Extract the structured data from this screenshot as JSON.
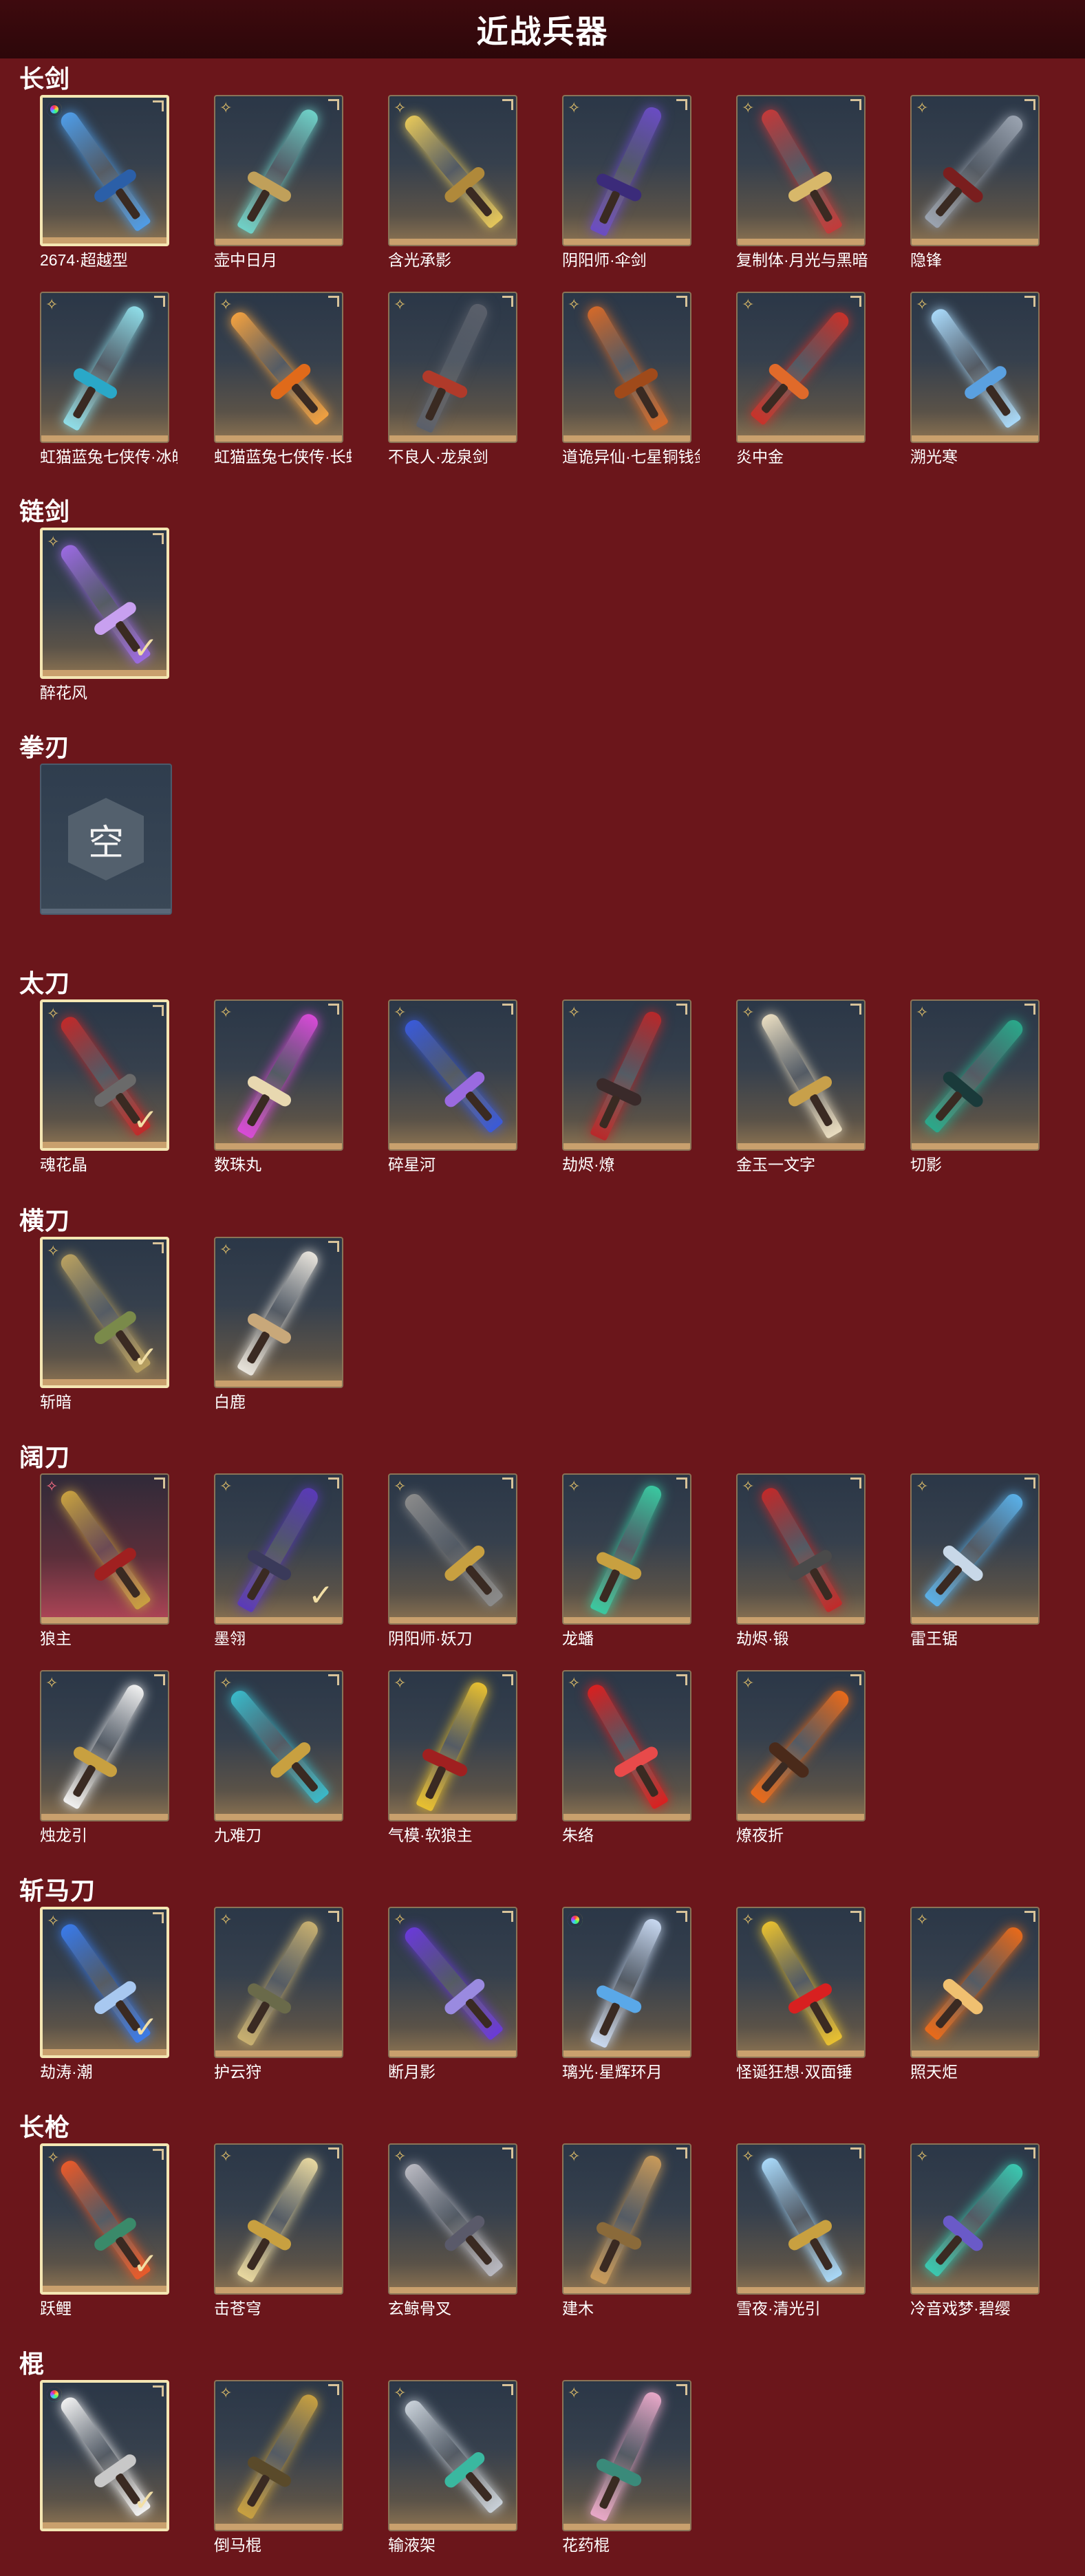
{
  "header": {
    "title": "近战兵器"
  },
  "sections": [
    {
      "key": "changjian",
      "title": "长剑",
      "rows": [
        [
          {
            "label": "2674·超越型",
            "rarity": "rainbow",
            "selected": true,
            "checked": false,
            "blade": "#4f9ce6",
            "guard": "#2b5fa8"
          },
          {
            "label": "壶中日月",
            "rarity": "gold",
            "selected": false,
            "checked": false,
            "blade": "#6fd1c8",
            "guard": "#c0a05a"
          },
          {
            "label": "含光承影",
            "rarity": "gold",
            "selected": false,
            "checked": false,
            "blade": "#e4c65a",
            "guard": "#b0893a"
          },
          {
            "label": "阴阳师·伞剑",
            "rarity": "gold",
            "selected": false,
            "checked": false,
            "blade": "#6a4cc4",
            "guard": "#3b2b7a"
          },
          {
            "label": "复制体·月光与黑暗",
            "rarity": "gold",
            "selected": false,
            "checked": false,
            "blade": "#c23a3a",
            "guard": "#d8b86a"
          },
          {
            "label": "隐锋",
            "rarity": "gold",
            "selected": false,
            "checked": false,
            "blade": "#9aa3b0",
            "guard": "#7a1e1e"
          }
        ],
        [
          {
            "label": "虹猫蓝兔七侠传·冰魄...",
            "rarity": "gold",
            "selected": false,
            "checked": false,
            "blade": "#8fdde8",
            "guard": "#2aa8c8"
          },
          {
            "label": "虹猫蓝兔七侠传·长虹...",
            "rarity": "gold",
            "selected": false,
            "checked": false,
            "blade": "#f0a040",
            "guard": "#e06a1a"
          },
          {
            "label": "不良人·龙泉剑",
            "rarity": "gold",
            "selected": false,
            "checked": false,
            "blade": "#5a5f6a",
            "guard": "#b03a2a"
          },
          {
            "label": "道诡异仙·七星铜钱剑",
            "rarity": "gold",
            "selected": false,
            "checked": false,
            "blade": "#d2692a",
            "guard": "#a04a1a"
          },
          {
            "label": "炎中金",
            "rarity": "gold",
            "selected": false,
            "checked": false,
            "blade": "#c8322a",
            "guard": "#e06a2a"
          },
          {
            "label": "溯光寒",
            "rarity": "gold",
            "selected": false,
            "checked": false,
            "blade": "#a8d8f8",
            "guard": "#5aa0e0"
          }
        ]
      ]
    },
    {
      "key": "lianjian",
      "title": "链剑",
      "rows": [
        [
          {
            "label": "醉花风",
            "rarity": "gold",
            "selected": true,
            "checked": true,
            "blade": "#9a6ae0",
            "guard": "#c8a0f0"
          }
        ]
      ]
    },
    {
      "key": "quanren",
      "title": "拳刃",
      "rows": [],
      "empty_label": "空"
    },
    {
      "key": "taidao",
      "title": "太刀",
      "rows": [
        [
          {
            "label": "魂花晶",
            "rarity": "gold",
            "selected": true,
            "checked": true,
            "blade": "#c02a2a",
            "guard": "#6a6a6a"
          },
          {
            "label": "数珠丸",
            "rarity": "gold",
            "selected": false,
            "checked": false,
            "blade": "#d84ad8",
            "guard": "#e8d8b0"
          },
          {
            "label": "碎星河",
            "rarity": "gold",
            "selected": false,
            "checked": false,
            "blade": "#3a5ad8",
            "guard": "#9a6ae0"
          },
          {
            "label": "劫烬·燎",
            "rarity": "gold",
            "selected": false,
            "checked": false,
            "blade": "#b8282a",
            "guard": "#3a2a2a"
          },
          {
            "label": "金玉一文字",
            "rarity": "gold",
            "selected": false,
            "checked": false,
            "blade": "#e8dcc0",
            "guard": "#c8a04a"
          },
          {
            "label": "切影",
            "rarity": "gold",
            "selected": false,
            "checked": false,
            "blade": "#2aa88a",
            "guard": "#1a3a3a"
          }
        ]
      ]
    },
    {
      "key": "hengdao",
      "title": "横刀",
      "rows": [
        [
          {
            "label": "斩暗",
            "rarity": "gold",
            "selected": true,
            "checked": true,
            "blade": "#b8a060",
            "guard": "#7a8a4a"
          },
          {
            "label": "白鹿",
            "rarity": "gold",
            "selected": false,
            "checked": false,
            "blade": "#e8e4dc",
            "guard": "#c8a87a"
          }
        ]
      ]
    },
    {
      "key": "kuodao",
      "title": "阔刀",
      "rows": [
        [
          {
            "label": "狼主",
            "rarity": "pinkstar",
            "selected": false,
            "checked": false,
            "pink": true,
            "blade": "#c8a040",
            "guard": "#a02020"
          },
          {
            "label": "墨翎",
            "rarity": "gold",
            "selected": false,
            "checked": true,
            "blade": "#5a3ab8",
            "guard": "#3a3a5a"
          },
          {
            "label": "阴阳师·妖刀",
            "rarity": "gold",
            "selected": false,
            "checked": false,
            "blade": "#8a8a8a",
            "guard": "#c8a040"
          },
          {
            "label": "龙蟠",
            "rarity": "gold",
            "selected": false,
            "checked": false,
            "blade": "#3ac8a0",
            "guard": "#c8a040"
          },
          {
            "label": "劫烬·锻",
            "rarity": "gold",
            "selected": false,
            "checked": false,
            "blade": "#c02a2a",
            "guard": "#4a4a4a"
          },
          {
            "label": "雷王锯",
            "rarity": "gold",
            "selected": false,
            "checked": false,
            "blade": "#5ab0e8",
            "guard": "#c8d8e8"
          }
        ],
        [
          {
            "label": "烛龙引",
            "rarity": "gold",
            "selected": false,
            "checked": false,
            "blade": "#f0f0f0",
            "guard": "#c8a040"
          },
          {
            "label": "九难刀",
            "rarity": "gold",
            "selected": false,
            "checked": false,
            "blade": "#3ab8c8",
            "guard": "#c8a040"
          },
          {
            "label": "气模·软狼主",
            "rarity": "gold",
            "selected": false,
            "checked": false,
            "blade": "#e8c030",
            "guard": "#a02020"
          },
          {
            "label": "朱络",
            "rarity": "gold",
            "selected": false,
            "checked": false,
            "blade": "#d82020",
            "guard": "#e84a4a"
          },
          {
            "label": "燎夜折",
            "rarity": "gold",
            "selected": false,
            "checked": false,
            "blade": "#e86a1a",
            "guard": "#4a2a1a"
          }
        ]
      ]
    },
    {
      "key": "zhanmadao",
      "title": "斩马刀",
      "rows": [
        [
          {
            "label": "劫涛·潮",
            "rarity": "gold",
            "selected": true,
            "checked": true,
            "blade": "#3a7ae8",
            "guard": "#a8c8f0"
          },
          {
            "label": "护云狩",
            "rarity": "gold",
            "selected": false,
            "checked": false,
            "blade": "#c8b070",
            "guard": "#6a6a4a"
          },
          {
            "label": "断月影",
            "rarity": "gold",
            "selected": false,
            "checked": false,
            "blade": "#6a3ad8",
            "guard": "#9a8ae0"
          },
          {
            "label": "璃光·星辉环月",
            "rarity": "rainbow",
            "selected": false,
            "checked": false,
            "blade": "#c8d8f0",
            "guard": "#5aa8e8"
          },
          {
            "label": "怪诞狂想·双面锤",
            "rarity": "gold",
            "selected": false,
            "checked": false,
            "blade": "#e8c030",
            "guard": "#d82020"
          },
          {
            "label": "照天炬",
            "rarity": "gold",
            "selected": false,
            "checked": false,
            "blade": "#e86a1a",
            "guard": "#f0c070"
          }
        ]
      ]
    },
    {
      "key": "changqiang",
      "title": "长枪",
      "rows": [
        [
          {
            "label": "跃鲤",
            "rarity": "gold",
            "selected": true,
            "checked": true,
            "blade": "#e85a2a",
            "guard": "#3a8a6a"
          },
          {
            "label": "击苍穹",
            "rarity": "gold",
            "selected": false,
            "checked": false,
            "blade": "#e8d8a0",
            "guard": "#c8a040"
          },
          {
            "label": "玄鲸骨叉",
            "rarity": "gold",
            "selected": false,
            "checked": false,
            "blade": "#b8b8c0",
            "guard": "#5a5a6a"
          },
          {
            "label": "建木",
            "rarity": "gold",
            "selected": false,
            "checked": false,
            "blade": "#c89a5a",
            "guard": "#8a6a3a"
          },
          {
            "label": "雪夜·清光引",
            "rarity": "gold",
            "selected": false,
            "checked": false,
            "blade": "#a8d8f8",
            "guard": "#c8a040"
          },
          {
            "label": "冷音戏梦·碧缨",
            "rarity": "gold",
            "selected": false,
            "checked": false,
            "blade": "#3ac8b0",
            "guard": "#6a5ac8"
          }
        ]
      ]
    },
    {
      "key": "gun",
      "title": "棍",
      "rows": [
        [
          {
            "label": "",
            "rarity": "rainbow",
            "selected": true,
            "checked": true,
            "blade": "#f0f0f0",
            "guard": "#c8c8c8"
          },
          {
            "label": "倒马棍",
            "rarity": "gold",
            "selected": false,
            "checked": false,
            "blade": "#c8a040",
            "guard": "#5a4a2a"
          },
          {
            "label": "输液架",
            "rarity": "gold",
            "selected": false,
            "checked": false,
            "blade": "#c8d0d8",
            "guard": "#3ab8a0"
          },
          {
            "label": "花药棍",
            "rarity": "gold",
            "selected": false,
            "checked": false,
            "blade": "#e8a8c8",
            "guard": "#3a8a7a"
          }
        ]
      ]
    }
  ]
}
